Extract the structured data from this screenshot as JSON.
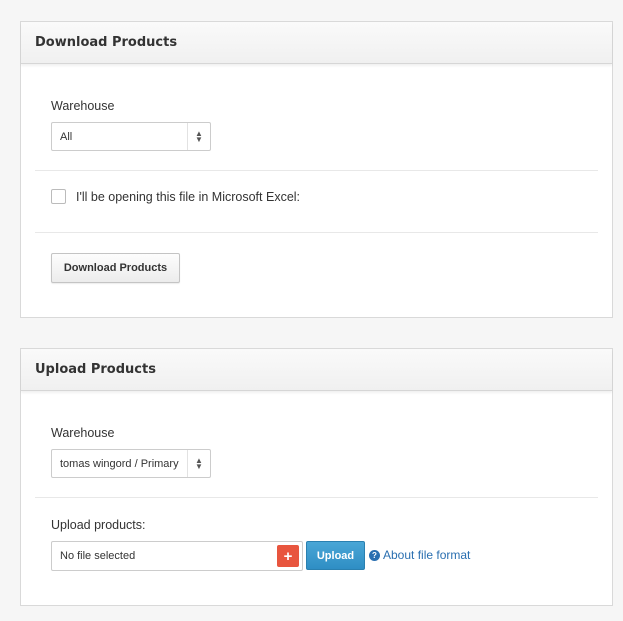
{
  "download_panel": {
    "title": "Download Products",
    "warehouse_label": "Warehouse",
    "warehouse_value": "All",
    "excel_checkbox_label": "I'll be opening this file in Microsoft Excel:",
    "excel_checked": false,
    "download_button_label": "Download Products"
  },
  "upload_panel": {
    "title": "Upload Products",
    "warehouse_label": "Warehouse",
    "warehouse_value": "tomas wingord / Primary",
    "upload_label": "Upload products:",
    "file_status": "No file selected",
    "add_file_icon": "+",
    "upload_button_label": "Upload",
    "help_icon": "?",
    "help_link_label": "About file format"
  },
  "colors": {
    "add_button": "#e8553e",
    "upload_button": "#3a9acc",
    "link": "#2a6fb0"
  }
}
